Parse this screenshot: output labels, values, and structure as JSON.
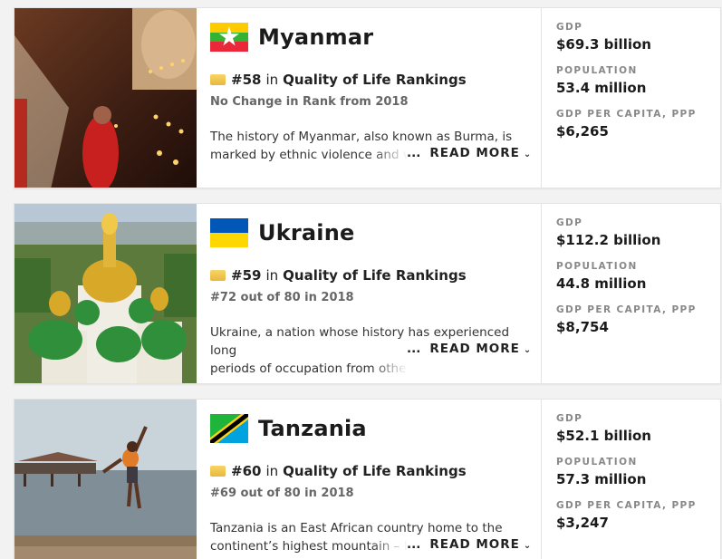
{
  "cards": [
    {
      "country": "Myanmar",
      "flag": "myanmar-flag",
      "photo": "monk-with-candles-photo",
      "rank": "#58",
      "rank_in": "in",
      "rank_list": "Quality of Life Rankings",
      "rank_change": "No Change in Rank from 2018",
      "desc_line1": "The history of Myanmar, also known as Burma, is",
      "desc_line2": "marked by ethnic violence and wid",
      "read_more_dots": "...",
      "read_more": "READ MORE",
      "stats": [
        {
          "label": "GDP",
          "value": "$69.3 billion"
        },
        {
          "label": "POPULATION",
          "value": "53.4 million"
        },
        {
          "label": "GDP PER CAPITA, PPP",
          "value": "$6,265"
        }
      ]
    },
    {
      "country": "Ukraine",
      "flag": "ukraine-flag",
      "photo": "cathedral-domes-photo",
      "rank": "#59",
      "rank_in": "in",
      "rank_list": "Quality of Life Rankings",
      "rank_change": "#72 out of 80 in 2018",
      "desc_line1": "Ukraine, a nation whose history has experienced long",
      "desc_line2": "periods of occupation from other c",
      "read_more_dots": "...",
      "read_more": "READ MORE",
      "stats": [
        {
          "label": "GDP",
          "value": "$112.2 billion"
        },
        {
          "label": "POPULATION",
          "value": "44.8 million"
        },
        {
          "label": "GDP PER CAPITA, PPP",
          "value": "$8,754"
        }
      ]
    },
    {
      "country": "Tanzania",
      "flag": "tanzania-flag",
      "photo": "boy-jumping-into-sea-photo",
      "rank": "#60",
      "rank_in": "in",
      "rank_list": "Quality of Life Rankings",
      "rank_change": "#69 out of 80 in 2018",
      "desc_line1": "Tanzania is an East African country home to the",
      "desc_line2": "continent’s highest mountain – Kili",
      "read_more_dots": "...",
      "read_more": "READ MORE",
      "stats": [
        {
          "label": "GDP",
          "value": "$52.1 billion"
        },
        {
          "label": "POPULATION",
          "value": "57.3 million"
        },
        {
          "label": "GDP PER CAPITA, PPP",
          "value": "$3,247"
        }
      ]
    }
  ],
  "colors": {
    "myanmar_yellow": "#fecb00",
    "myanmar_green": "#34b233",
    "myanmar_red": "#ea2839",
    "ukraine_blue": "#0057b7",
    "ukraine_yellow": "#ffd700",
    "tanzania_green": "#1eb53a",
    "tanzania_blue": "#00a3dd",
    "tanzania_yellow": "#fcd116"
  }
}
